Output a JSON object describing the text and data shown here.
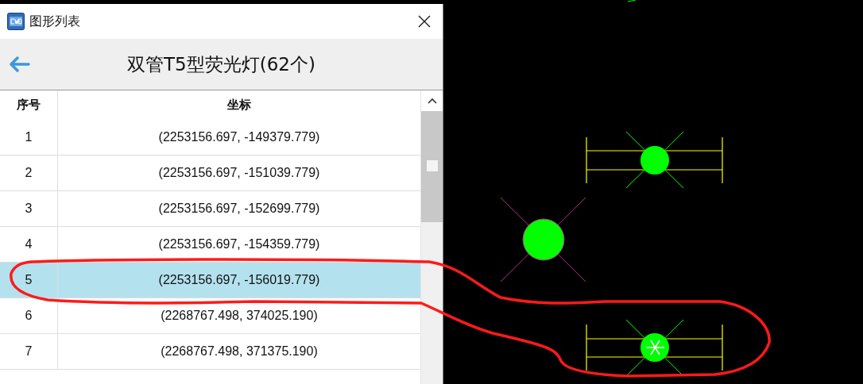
{
  "window": {
    "title": "图形列表"
  },
  "header": {
    "title": "双管T5型荧光灯(62个)"
  },
  "table": {
    "columns": [
      "序号",
      "坐标"
    ],
    "rows": [
      {
        "index": "1",
        "coordinate": "(2253156.697, -149379.779)",
        "selected": false
      },
      {
        "index": "2",
        "coordinate": "(2253156.697, -151039.779)",
        "selected": false
      },
      {
        "index": "3",
        "coordinate": "(2253156.697, -152699.779)",
        "selected": false
      },
      {
        "index": "4",
        "coordinate": "(2253156.697, -154359.779)",
        "selected": false
      },
      {
        "index": "5",
        "coordinate": "(2253156.697, -156019.779)",
        "selected": true
      },
      {
        "index": "6",
        "coordinate": "(2268767.498, 374025.190)",
        "selected": false
      },
      {
        "index": "7",
        "coordinate": "(2268767.498, 371375.190)",
        "selected": false
      }
    ]
  }
}
